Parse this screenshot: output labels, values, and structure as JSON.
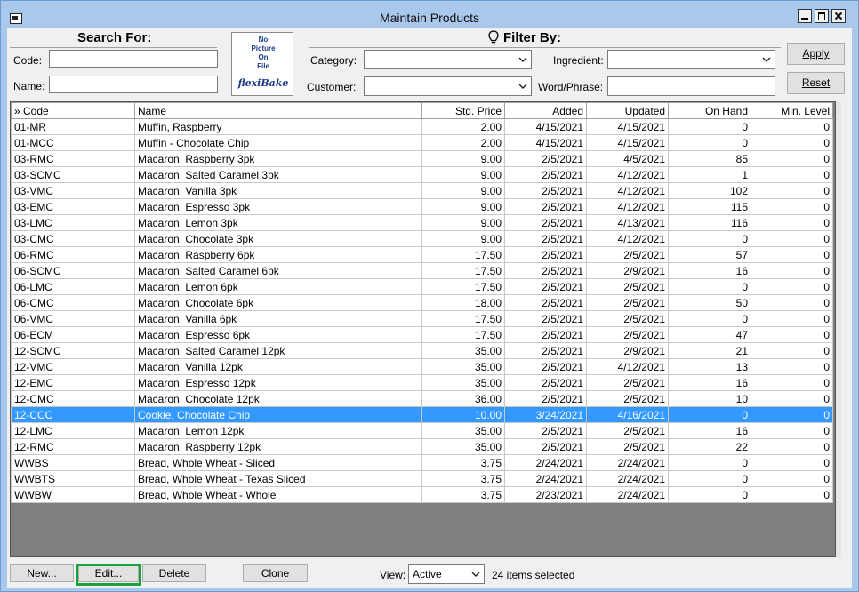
{
  "window": {
    "title": "Maintain Products"
  },
  "search": {
    "title": "Search For:",
    "code_label": "Code:",
    "code_value": "",
    "name_label": "Name:",
    "name_value": ""
  },
  "picture": {
    "text": "No\nPicture\nOn\nFile",
    "logo": "flexiBake"
  },
  "filter": {
    "title": "Filter By:",
    "category_label": "Category:",
    "category_value": "",
    "ingredient_label": "Ingredient:",
    "ingredient_value": "",
    "customer_label": "Customer:",
    "customer_value": "",
    "word_label": "Word/Phrase:",
    "word_value": ""
  },
  "buttons": {
    "apply": "Apply",
    "reset": "Reset",
    "new": "New...",
    "edit": "Edit...",
    "delete": "Delete",
    "clone": "Clone"
  },
  "table": {
    "columns": [
      "» Code",
      "Name",
      "Std. Price",
      "Added",
      "Updated",
      "On Hand",
      "Min. Level"
    ],
    "rows": [
      [
        "01-MR",
        "Muffin, Raspberry",
        "2.00",
        "4/15/2021",
        "4/15/2021",
        "0",
        "0"
      ],
      [
        "01-MCC",
        "Muffin - Chocolate Chip",
        "2.00",
        "4/15/2021",
        "4/15/2021",
        "0",
        "0"
      ],
      [
        "03-RMC",
        "Macaron, Raspberry 3pk",
        "9.00",
        "2/5/2021",
        "4/5/2021",
        "85",
        "0"
      ],
      [
        "03-SCMC",
        "Macaron, Salted Caramel 3pk",
        "9.00",
        "2/5/2021",
        "4/12/2021",
        "1",
        "0"
      ],
      [
        "03-VMC",
        "Macaron, Vanilla 3pk",
        "9.00",
        "2/5/2021",
        "4/12/2021",
        "102",
        "0"
      ],
      [
        "03-EMC",
        "Macaron, Espresso 3pk",
        "9.00",
        "2/5/2021",
        "4/12/2021",
        "115",
        "0"
      ],
      [
        "03-LMC",
        "Macaron, Lemon 3pk",
        "9.00",
        "2/5/2021",
        "4/13/2021",
        "116",
        "0"
      ],
      [
        "03-CMC",
        "Macaron, Chocolate 3pk",
        "9.00",
        "2/5/2021",
        "4/12/2021",
        "0",
        "0"
      ],
      [
        "06-RMC",
        "Macaron, Raspberry 6pk",
        "17.50",
        "2/5/2021",
        "2/5/2021",
        "57",
        "0"
      ],
      [
        "06-SCMC",
        "Macaron, Salted Caramel 6pk",
        "17.50",
        "2/5/2021",
        "2/9/2021",
        "16",
        "0"
      ],
      [
        "06-LMC",
        "Macaron, Lemon 6pk",
        "17.50",
        "2/5/2021",
        "2/5/2021",
        "0",
        "0"
      ],
      [
        "06-CMC",
        "Macaron, Chocolate 6pk",
        "18.00",
        "2/5/2021",
        "2/5/2021",
        "50",
        "0"
      ],
      [
        "06-VMC",
        "Macaron, Vanilla 6pk",
        "17.50",
        "2/5/2021",
        "2/5/2021",
        "0",
        "0"
      ],
      [
        "06-ECM",
        "Macaron, Espresso 6pk",
        "17.50",
        "2/5/2021",
        "2/5/2021",
        "47",
        "0"
      ],
      [
        "12-SCMC",
        "Macaron, Salted Caramel 12pk",
        "35.00",
        "2/5/2021",
        "2/9/2021",
        "21",
        "0"
      ],
      [
        "12-VMC",
        "Macaron, Vanilla 12pk",
        "35.00",
        "2/5/2021",
        "4/12/2021",
        "13",
        "0"
      ],
      [
        "12-EMC",
        "Macaron, Espresso 12pk",
        "35.00",
        "2/5/2021",
        "2/5/2021",
        "16",
        "0"
      ],
      [
        "12-CMC",
        "Macaron, Chocolate 12pk",
        "36.00",
        "2/5/2021",
        "2/5/2021",
        "10",
        "0"
      ],
      [
        "12-CCC",
        "Cookie, Chocolate Chip",
        "10.00",
        "3/24/2021",
        "4/16/2021",
        "0",
        "0"
      ],
      [
        "12-LMC",
        "Macaron, Lemon 12pk",
        "35.00",
        "2/5/2021",
        "2/5/2021",
        "16",
        "0"
      ],
      [
        "12-RMC",
        "Macaron, Raspberry 12pk",
        "35.00",
        "2/5/2021",
        "2/5/2021",
        "22",
        "0"
      ],
      [
        "WWBS",
        "Bread, Whole Wheat - Sliced",
        "3.75",
        "2/24/2021",
        "2/24/2021",
        "0",
        "0"
      ],
      [
        "WWBTS",
        "Bread, Whole Wheat - Texas Sliced",
        "3.75",
        "2/24/2021",
        "2/24/2021",
        "0",
        "0"
      ],
      [
        "WWBW",
        "Bread, Whole Wheat - Whole",
        "3.75",
        "2/23/2021",
        "2/24/2021",
        "0",
        "0"
      ]
    ],
    "selected_index": 18,
    "selected_color": "#3399ff"
  },
  "view": {
    "label": "View:",
    "value": "Active"
  },
  "status": "24 items selected",
  "icons": {
    "filter": "lightbulb-icon",
    "dropdown": "chevron-down-icon"
  }
}
